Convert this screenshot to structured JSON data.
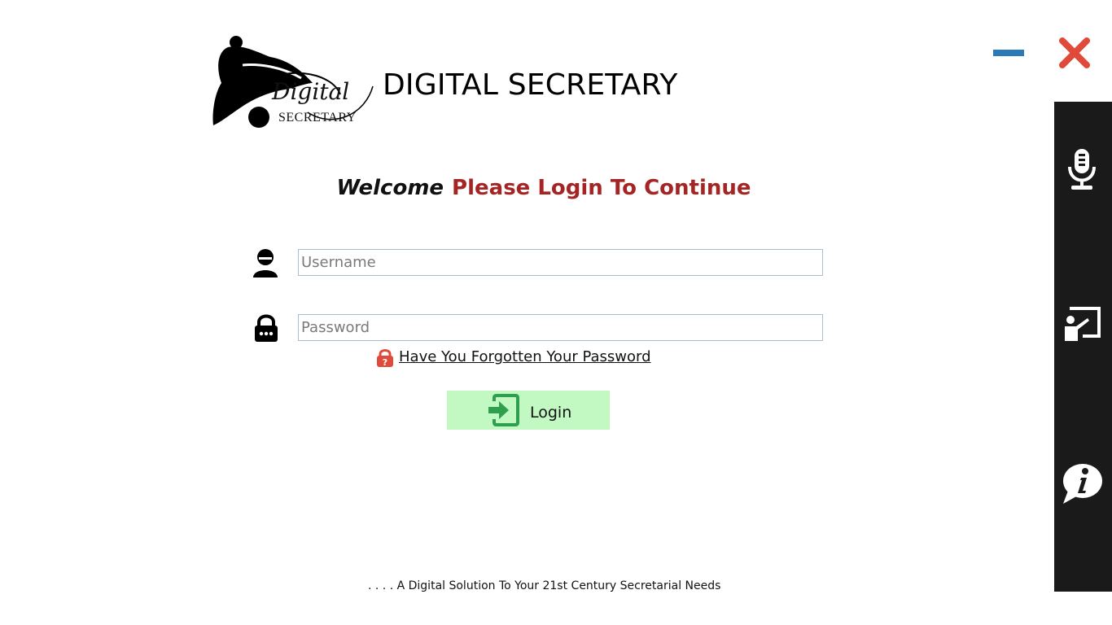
{
  "app": {
    "title": "DIGITAL SECRETARY",
    "logo_script": "Digital",
    "logo_caps": "SECRETARY"
  },
  "window_controls": {
    "minimize_icon": "minus-icon",
    "close_icon": "close-x-icon",
    "minimize_color": "#2a7ab8",
    "close_color": "#e04a3a"
  },
  "welcome": {
    "greeting": "Welcome",
    "message": "Please Login To Continue",
    "message_color": "#a52525"
  },
  "form": {
    "username_placeholder": "Username",
    "username_value": "",
    "password_placeholder": "Password",
    "password_value": "",
    "username_icon": "user-icon",
    "password_icon": "padlock-icon"
  },
  "forgot": {
    "label": "Have You Forgotten Your Password",
    "icon": "lock-question-icon"
  },
  "login": {
    "label": "Login",
    "icon": "login-enter-icon",
    "background": "#c2f8c2"
  },
  "sidebar": {
    "items": [
      {
        "icon": "microphone-icon"
      },
      {
        "icon": "presentation-board-icon"
      },
      {
        "icon": "info-bubble-icon"
      }
    ]
  },
  "footer": {
    "tagline": ". . . . A Digital Solution To Your 21st Century Secretarial Needs"
  }
}
